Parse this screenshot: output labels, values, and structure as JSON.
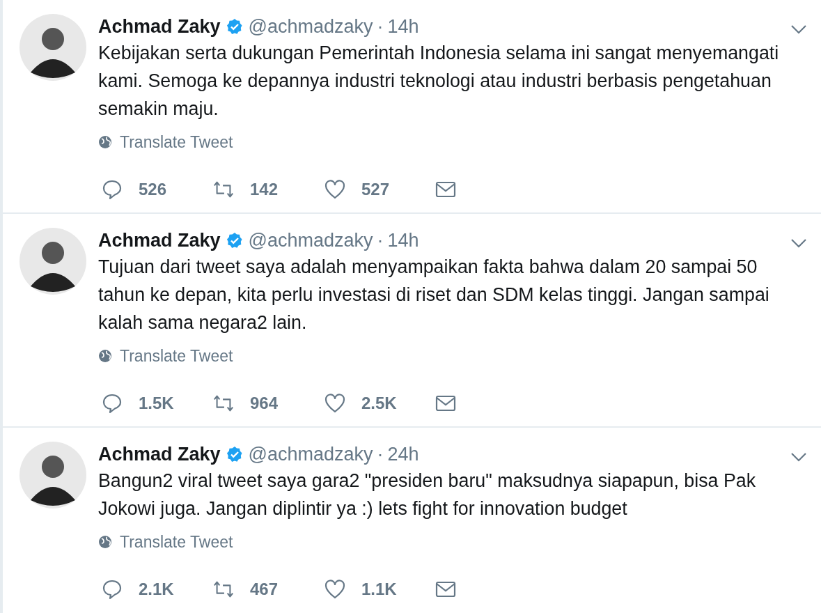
{
  "tweets": [
    {
      "name": "Achmad Zaky",
      "verified": true,
      "handle": "@achmadzaky",
      "separator": "·",
      "time": "14h",
      "text": "Kebijakan serta dukungan Pemerintah Indonesia selama ini sangat menyemangati kami. Semoga ke depannya industri teknologi atau industri berbasis pengetahuan semakin maju.",
      "translate": "Translate Tweet",
      "replies": "526",
      "retweets": "142",
      "likes": "527"
    },
    {
      "name": "Achmad Zaky",
      "verified": true,
      "handle": "@achmadzaky",
      "separator": "·",
      "time": "14h",
      "text": "Tujuan dari tweet saya adalah menyampaikan fakta bahwa dalam 20 sampai 50 tahun ke depan, kita perlu investasi di riset dan SDM kelas tinggi. Jangan sampai kalah sama negara2 lain.",
      "translate": "Translate Tweet",
      "replies": "1.5K",
      "retweets": "964",
      "likes": "2.5K"
    },
    {
      "name": "Achmad Zaky",
      "verified": true,
      "handle": "@achmadzaky",
      "separator": "·",
      "time": "24h",
      "text": "Bangun2 viral tweet saya gara2 \"presiden baru\" maksudnya siapapun, bisa Pak Jokowi juga. Jangan diplintir ya :) lets fight for innovation budget",
      "translate": "Translate Tweet",
      "replies": "2.1K",
      "retweets": "467",
      "likes": "1.1K"
    }
  ]
}
